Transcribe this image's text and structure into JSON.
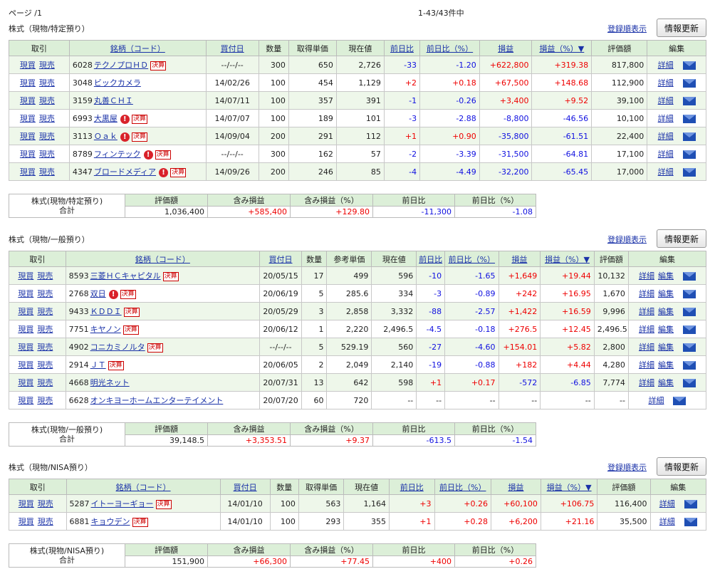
{
  "page_label": "ページ /1",
  "count_label": "1-43/43件中",
  "sections": [
    {
      "title": "株式（現物/特定預り）",
      "register_label": "登録順表示",
      "refresh_label": "情報更新",
      "headers": [
        "取引",
        "銘柄（コード）",
        "買付日",
        "数量",
        "取得単価",
        "現在値",
        "前日比",
        "前日比（%）",
        "損益",
        "損益（%）▼",
        "評価額",
        "編集"
      ],
      "rows": [
        {
          "buy": "現買",
          "sell": "現売",
          "code": "6028",
          "name": "テクノプロＨＤ",
          "alert": false,
          "kessan": true,
          "date": "--/--/--",
          "qty": "300",
          "cost": "650",
          "price": "2,726",
          "chg": "-33",
          "chgpct": "-1.20",
          "pl": "+622,800",
          "plpct": "+319.38",
          "value": "817,800",
          "detail": "詳細",
          "edit": ""
        },
        {
          "buy": "現買",
          "sell": "現売",
          "code": "3048",
          "name": "ビックカメラ",
          "alert": false,
          "kessan": false,
          "date": "14/02/26",
          "qty": "100",
          "cost": "454",
          "price": "1,129",
          "chg": "+2",
          "chgpct": "+0.18",
          "pl": "+67,500",
          "plpct": "+148.68",
          "value": "112,900",
          "detail": "詳細",
          "edit": ""
        },
        {
          "buy": "現買",
          "sell": "現売",
          "code": "3159",
          "name": "丸善ＣＨＩ",
          "alert": false,
          "kessan": false,
          "date": "14/07/11",
          "qty": "100",
          "cost": "357",
          "price": "391",
          "chg": "-1",
          "chgpct": "-0.26",
          "pl": "+3,400",
          "plpct": "+9.52",
          "value": "39,100",
          "detail": "詳細",
          "edit": ""
        },
        {
          "buy": "現買",
          "sell": "現売",
          "code": "6993",
          "name": "大黒屋",
          "alert": true,
          "kessan": true,
          "date": "14/07/07",
          "qty": "100",
          "cost": "189",
          "price": "101",
          "chg": "-3",
          "chgpct": "-2.88",
          "pl": "-8,800",
          "plpct": "-46.56",
          "value": "10,100",
          "detail": "詳細",
          "edit": ""
        },
        {
          "buy": "現買",
          "sell": "現売",
          "code": "3113",
          "name": "Ｏａｋ",
          "alert": true,
          "kessan": true,
          "date": "14/09/04",
          "qty": "200",
          "cost": "291",
          "price": "112",
          "chg": "+1",
          "chgpct": "+0.90",
          "pl": "-35,800",
          "plpct": "-61.51",
          "value": "22,400",
          "detail": "詳細",
          "edit": ""
        },
        {
          "buy": "現買",
          "sell": "現売",
          "code": "8789",
          "name": "フィンテック",
          "alert": true,
          "kessan": true,
          "date": "--/--/--",
          "qty": "300",
          "cost": "162",
          "price": "57",
          "chg": "-2",
          "chgpct": "-3.39",
          "pl": "-31,500",
          "plpct": "-64.81",
          "value": "17,100",
          "detail": "詳細",
          "edit": ""
        },
        {
          "buy": "現買",
          "sell": "現売",
          "code": "4347",
          "name": "ブロードメディア",
          "alert": true,
          "kessan": true,
          "date": "14/09/26",
          "qty": "200",
          "cost": "246",
          "price": "85",
          "chg": "-4",
          "chgpct": "-4.49",
          "pl": "-32,200",
          "plpct": "-65.45",
          "value": "17,000",
          "detail": "詳細",
          "edit": ""
        }
      ],
      "summary": {
        "label1": "株式(現物/特定預り)",
        "label2": "合計",
        "headers": [
          "評価額",
          "含み損益",
          "含み損益（%）",
          "前日比",
          "前日比（%）"
        ],
        "values": [
          "1,036,400",
          "+585,400",
          "+129.80",
          "-11,300",
          "-1.08"
        ]
      }
    },
    {
      "title": "株式（現物/一般預り）",
      "register_label": "登録順表示",
      "refresh_label": "情報更新",
      "headers": [
        "取引",
        "銘柄（コード）",
        "買付日",
        "数量",
        "参考単価",
        "現在値",
        "前日比",
        "前日比（%）",
        "損益",
        "損益（%）▼",
        "評価額",
        "編集"
      ],
      "rows": [
        {
          "buy": "現買",
          "sell": "現売",
          "code": "8593",
          "name": "三菱ＨＣキャピタル",
          "alert": false,
          "kessan": true,
          "date": "20/05/15",
          "qty": "17",
          "cost": "499",
          "price": "596",
          "chg": "-10",
          "chgpct": "-1.65",
          "pl": "+1,649",
          "plpct": "+19.44",
          "value": "10,132",
          "detail": "詳細",
          "edit": "編集"
        },
        {
          "buy": "現買",
          "sell": "現売",
          "code": "2768",
          "name": "双日",
          "alert": true,
          "kessan": true,
          "date": "20/06/19",
          "qty": "5",
          "cost": "285.6",
          "price": "334",
          "chg": "-3",
          "chgpct": "-0.89",
          "pl": "+242",
          "plpct": "+16.95",
          "value": "1,670",
          "detail": "詳細",
          "edit": "編集"
        },
        {
          "buy": "現買",
          "sell": "現売",
          "code": "9433",
          "name": "ＫＤＤＩ",
          "alert": false,
          "kessan": true,
          "date": "20/05/29",
          "qty": "3",
          "cost": "2,858",
          "price": "3,332",
          "chg": "-88",
          "chgpct": "-2.57",
          "pl": "+1,422",
          "plpct": "+16.59",
          "value": "9,996",
          "detail": "詳細",
          "edit": "編集"
        },
        {
          "buy": "現買",
          "sell": "現売",
          "code": "7751",
          "name": "キヤノン",
          "alert": false,
          "kessan": true,
          "date": "20/06/12",
          "qty": "1",
          "cost": "2,220",
          "price": "2,496.5",
          "chg": "-4.5",
          "chgpct": "-0.18",
          "pl": "+276.5",
          "plpct": "+12.45",
          "value": "2,496.5",
          "detail": "詳細",
          "edit": "編集"
        },
        {
          "buy": "現買",
          "sell": "現売",
          "code": "4902",
          "name": "コニカミノルタ",
          "alert": false,
          "kessan": true,
          "date": "--/--/--",
          "qty": "5",
          "cost": "529.19",
          "price": "560",
          "chg": "-27",
          "chgpct": "-4.60",
          "pl": "+154.01",
          "plpct": "+5.82",
          "value": "2,800",
          "detail": "詳細",
          "edit": "編集"
        },
        {
          "buy": "現買",
          "sell": "現売",
          "code": "2914",
          "name": "ＪＴ",
          "alert": false,
          "kessan": true,
          "date": "20/06/05",
          "qty": "2",
          "cost": "2,049",
          "price": "2,140",
          "chg": "-19",
          "chgpct": "-0.88",
          "pl": "+182",
          "plpct": "+4.44",
          "value": "4,280",
          "detail": "詳細",
          "edit": "編集"
        },
        {
          "buy": "現買",
          "sell": "現売",
          "code": "4668",
          "name": "明光ネット",
          "alert": false,
          "kessan": false,
          "date": "20/07/31",
          "qty": "13",
          "cost": "642",
          "price": "598",
          "chg": "+1",
          "chgpct": "+0.17",
          "pl": "-572",
          "plpct": "-6.85",
          "value": "7,774",
          "detail": "詳細",
          "edit": "編集"
        },
        {
          "buy": "現買",
          "sell": "現売",
          "code": "6628",
          "name": "オンキヨーホームエンターテイメント",
          "alert": false,
          "kessan": false,
          "date": "20/07/20",
          "qty": "60",
          "cost": "720",
          "price": "--",
          "chg": "--",
          "chgpct": "--",
          "pl": "--",
          "plpct": "--",
          "value": "--",
          "detail": "詳細",
          "edit": ""
        }
      ],
      "summary": {
        "label1": "株式(現物/一般預り)",
        "label2": "合計",
        "headers": [
          "評価額",
          "含み損益",
          "含み損益（%）",
          "前日比",
          "前日比（%）"
        ],
        "values": [
          "39,148.5",
          "+3,353.51",
          "+9.37",
          "-613.5",
          "-1.54"
        ]
      }
    },
    {
      "title": "株式（現物/NISA預り）",
      "register_label": "登録順表示",
      "refresh_label": "情報更新",
      "headers": [
        "取引",
        "銘柄（コード）",
        "買付日",
        "数量",
        "取得単価",
        "現在値",
        "前日比",
        "前日比（%）",
        "損益",
        "損益（%）▼",
        "評価額",
        "編集"
      ],
      "rows": [
        {
          "buy": "現買",
          "sell": "現売",
          "code": "5287",
          "name": "イトーヨーギョー",
          "alert": false,
          "kessan": true,
          "date": "14/01/10",
          "qty": "100",
          "cost": "563",
          "price": "1,164",
          "chg": "+3",
          "chgpct": "+0.26",
          "pl": "+60,100",
          "plpct": "+106.75",
          "value": "116,400",
          "detail": "詳細",
          "edit": ""
        },
        {
          "buy": "現買",
          "sell": "現売",
          "code": "6881",
          "name": "キョウデン",
          "alert": false,
          "kessan": true,
          "date": "14/01/10",
          "qty": "100",
          "cost": "293",
          "price": "355",
          "chg": "+1",
          "chgpct": "+0.28",
          "pl": "+6,200",
          "plpct": "+21.16",
          "value": "35,500",
          "detail": "詳細",
          "edit": ""
        }
      ],
      "summary": {
        "label1": "株式(現物/NISA預り)",
        "label2": "合計",
        "headers": [
          "評価額",
          "含み損益",
          "含み損益（%）",
          "前日比",
          "前日比（%）"
        ],
        "values": [
          "151,900",
          "+66,300",
          "+77.45",
          "+400",
          "+0.26"
        ]
      }
    }
  ],
  "kessan_label": "決算",
  "alert_glyph": "!",
  "colors": {
    "header_bg": "#dcefd8",
    "row_alt": "#eef7ea",
    "positive": "#e00000",
    "negative": "#1010e0",
    "link": "#1a32a8"
  }
}
